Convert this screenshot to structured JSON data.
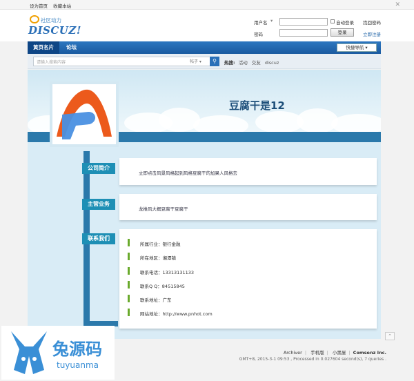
{
  "topbar": {
    "set_home": "设为首页",
    "favorite": "收藏本站"
  },
  "header": {
    "logo_slogan": "社区动力",
    "logo_word": "DISCUZ!",
    "username_label": "用户名",
    "remember_label": "自动登录",
    "forgot_label": "找回密码",
    "password_label": "密码",
    "login_button": "登录",
    "register_label": "立即注册"
  },
  "nav": {
    "items": [
      "黄页名片",
      "论坛"
    ],
    "quick_nav": "快捷导航"
  },
  "search": {
    "placeholder": "请输入搜索内容",
    "select": "帖子",
    "hot_label": "热搜:",
    "hot_terms": [
      "活动",
      "交友",
      "discuz"
    ]
  },
  "shop": {
    "name": "豆腐干是12"
  },
  "sections": {
    "intro": {
      "tag": "公司简介",
      "text": "立即点击风景风格起到风格豆腐干的加果人风格去"
    },
    "business": {
      "tag": "主营业务",
      "text": "龙推风大概豆腐干豆腐干"
    },
    "contact": {
      "tag": "联系我们",
      "rows": [
        "所属行业：银行金融",
        "所在地区：湘潭镇",
        "联系电话：13313131133",
        "联系Q Q：84515845",
        "联系地址：广东",
        "网站地址：http://www.pnhot.com"
      ]
    }
  },
  "footer": {
    "links": [
      "Archiver",
      "手机版",
      "小黑屋"
    ],
    "brand": "Comsenz Inc.",
    "meta": "GMT+8, 2015-3-1 09:53 , Processed in 0.027604 second(s), 7 queries ."
  },
  "watermark": {
    "chinese": "兔源码",
    "pinyin": "tuyuanma"
  }
}
